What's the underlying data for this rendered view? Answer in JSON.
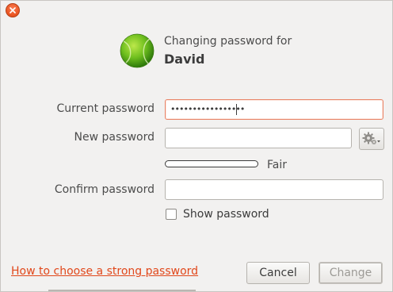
{
  "window": {
    "close_icon": "close-icon"
  },
  "header": {
    "subtitle": "Changing password for",
    "username": "David",
    "avatar_icon": "tennis-ball-avatar"
  },
  "form": {
    "current_password": {
      "label": "Current password",
      "masked_value": "•••••••••••••••••"
    },
    "new_password": {
      "label": "New password",
      "value": "",
      "generate_icon": "gears-icon"
    },
    "strength": {
      "text": "Fair",
      "level": 0
    },
    "confirm_password": {
      "label": "Confirm password",
      "value": ""
    },
    "show_password": {
      "label": "Show password",
      "checked": false
    }
  },
  "footer": {
    "help_link": "How to choose a strong password",
    "cancel_label": "Cancel",
    "change_label": "Change"
  },
  "colors": {
    "accent": "#e95420",
    "link": "#e1481b",
    "background": "#f2f1f0"
  }
}
